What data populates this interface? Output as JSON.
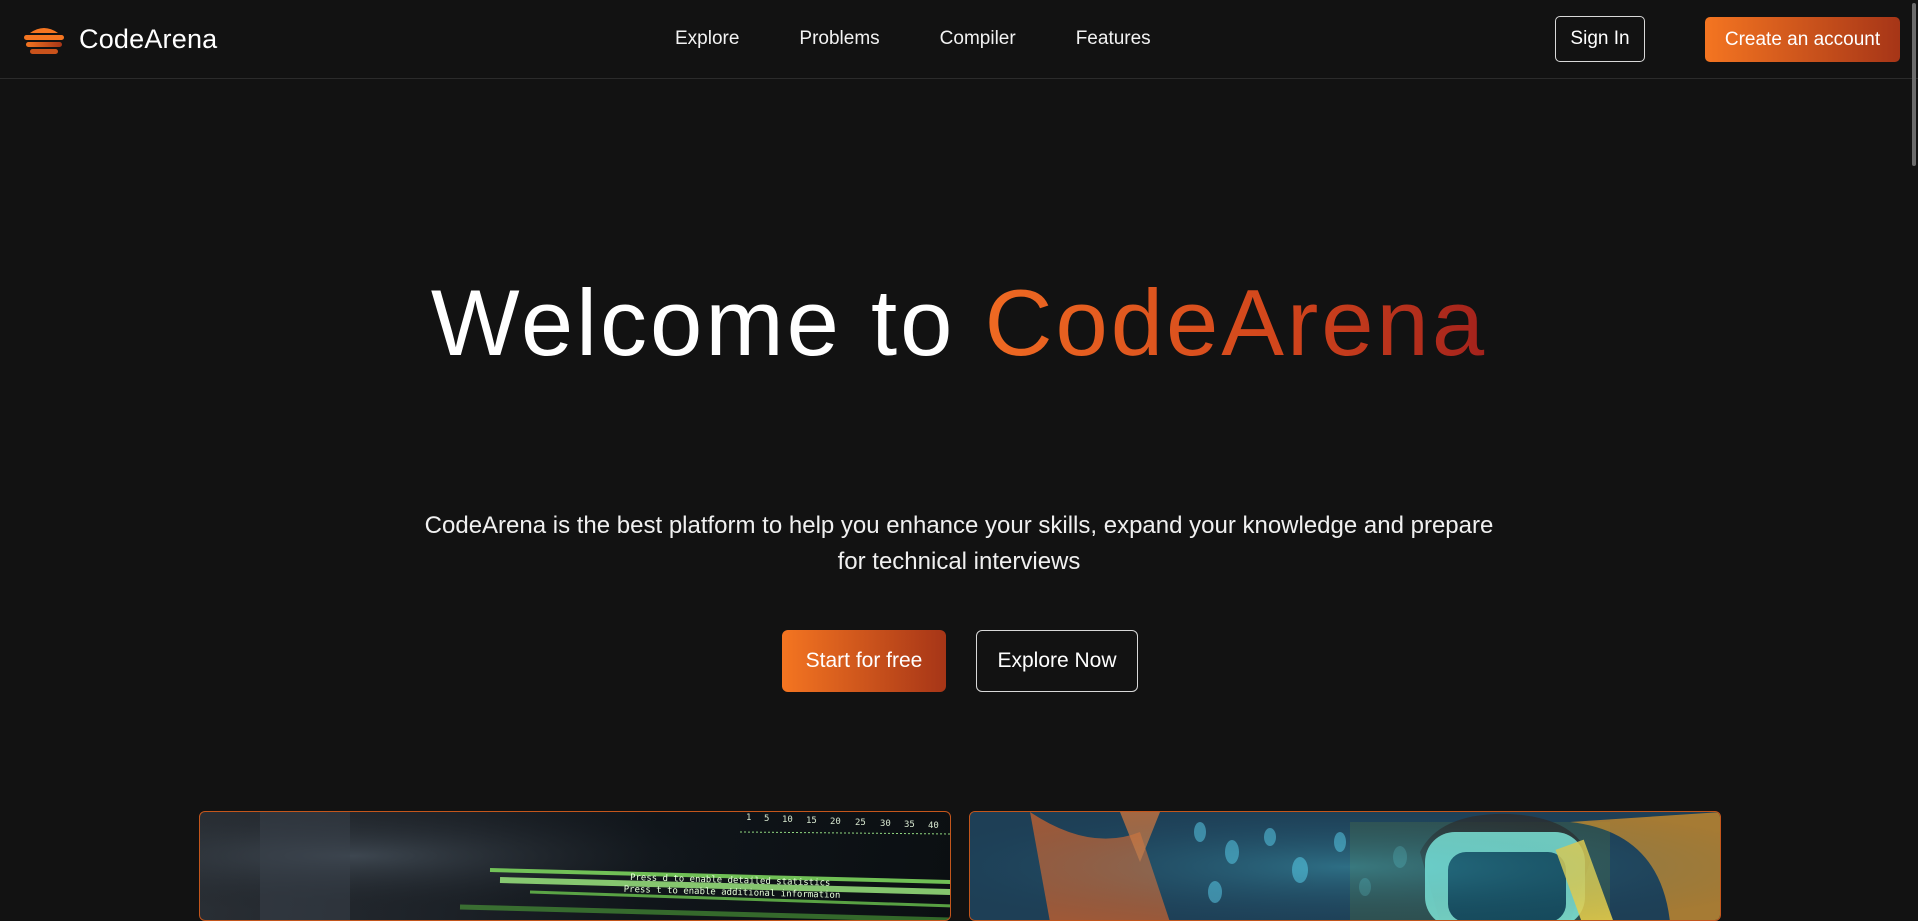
{
  "brand": {
    "name": "CodeArena",
    "logo_icon": "stacked-layers-logo-icon",
    "accent_color": "#f47521",
    "accent_dark": "#a63517"
  },
  "nav": {
    "links": [
      "Explore",
      "Problems",
      "Compiler",
      "Features"
    ],
    "signin_label": "Sign In",
    "create_label": "Create an account"
  },
  "hero": {
    "title_prefix": "Welcome to",
    "title_accent": "CodeArena",
    "subtitle": "CodeArena is the best platform to help you enhance your skills, expand your knowledge and prepare for technical interviews",
    "primary_cta": "Start for free",
    "secondary_cta": "Explore Now"
  },
  "cards": [
    {
      "image": "terminal-code-screen-image",
      "ruler_numbers": [
        "1",
        "5",
        "10",
        "15",
        "20",
        "25",
        "30",
        "35",
        "40"
      ],
      "terminal_lines": [
        "Press d to enable detailed statistics",
        "Press t to enable additional information"
      ]
    },
    {
      "image": "vr-headset-person-image"
    }
  ],
  "colors": {
    "background": "#121212",
    "border": "#2b2b2b",
    "card_border": "#c4561c"
  }
}
